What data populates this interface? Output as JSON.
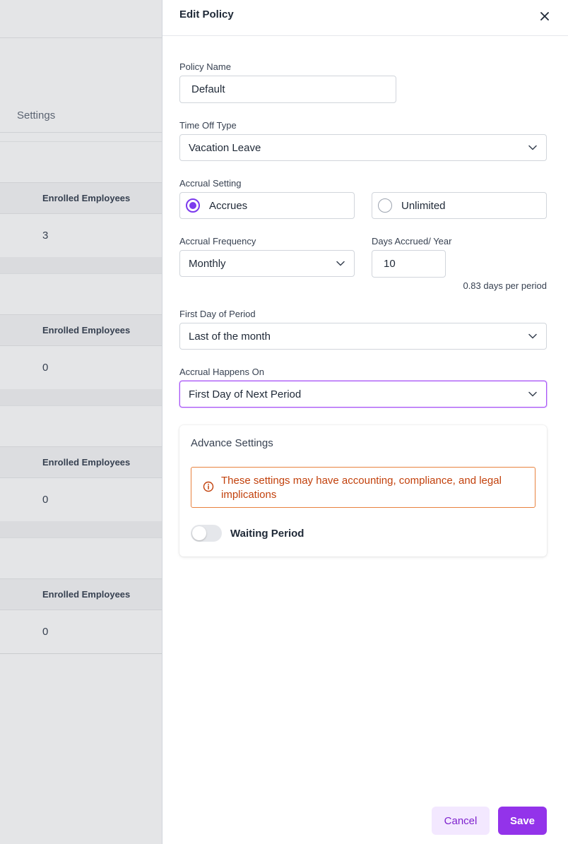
{
  "background": {
    "tab_label": "Settings",
    "cards": [
      {
        "column_header": "Enrolled Employees",
        "value": "3"
      },
      {
        "column_header": "Enrolled Employees",
        "value": "0"
      },
      {
        "column_header": "Enrolled Employees",
        "value": "0"
      },
      {
        "column_header": "Enrolled Employees",
        "value": "0"
      }
    ]
  },
  "drawer": {
    "title": "Edit Policy",
    "close_icon": "close-icon",
    "policy_name": {
      "label": "Policy Name",
      "value": "Default"
    },
    "time_off_type": {
      "label": "Time Off Type",
      "value": "Vacation Leave"
    },
    "accrual_setting": {
      "label": "Accrual Setting",
      "options": [
        {
          "label": "Accrues",
          "selected": true
        },
        {
          "label": "Unlimited",
          "selected": false
        }
      ]
    },
    "accrual_frequency": {
      "label": "Accrual Frequency",
      "value": "Monthly"
    },
    "days_accrued": {
      "label": "Days Accrued/ Year",
      "value": "10",
      "helper": "0.83 days per period"
    },
    "first_day_of_period": {
      "label": "First Day of Period",
      "value": "Last of the month"
    },
    "accrual_happens_on": {
      "label": "Accrual Happens On",
      "value": "First Day of Next Period"
    },
    "advance_settings": {
      "title": "Advance Settings",
      "warning": "These settings may have accounting, compliance, and legal implications",
      "warning_icon": "info-circle-icon",
      "waiting_period": {
        "label": "Waiting Period",
        "enabled": false
      }
    },
    "footer": {
      "cancel_label": "Cancel",
      "save_label": "Save"
    }
  },
  "colors": {
    "accent": "#9333ea",
    "accent_light": "#f3e8ff",
    "warning": "#c2410c",
    "warning_border": "#e8823f",
    "overlay": "#e4e5e7"
  }
}
